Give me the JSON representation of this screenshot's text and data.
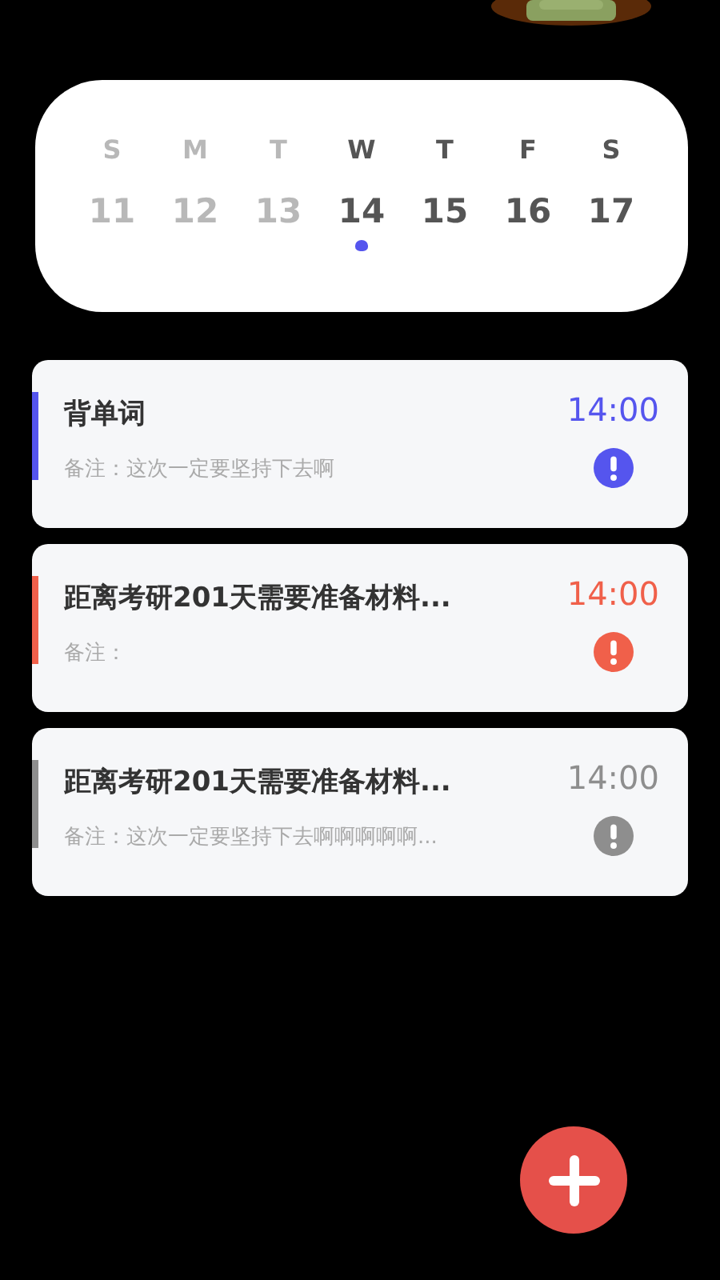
{
  "week": {
    "days": [
      {
        "weekday": "S",
        "date": "11",
        "past": true,
        "selected": false
      },
      {
        "weekday": "M",
        "date": "12",
        "past": true,
        "selected": false
      },
      {
        "weekday": "T",
        "date": "13",
        "past": true,
        "selected": false
      },
      {
        "weekday": "W",
        "date": "14",
        "past": false,
        "selected": true
      },
      {
        "weekday": "T",
        "date": "15",
        "past": false,
        "selected": false
      },
      {
        "weekday": "F",
        "date": "16",
        "past": false,
        "selected": false
      },
      {
        "weekday": "S",
        "date": "17",
        "past": false,
        "selected": false
      }
    ]
  },
  "tasks": [
    {
      "title": "背单词",
      "note": "备注：这次一定要坚持下去啊",
      "time": "14:00",
      "color": "#5555ee"
    },
    {
      "title": "距离考研201天需要准备材料...",
      "note": "备注：",
      "time": "14:00",
      "color": "#f0604a"
    },
    {
      "title": "距离考研201天需要准备材料...",
      "note": "备注：这次一定要坚持下去啊啊啊啊啊...",
      "time": "14:00",
      "color": "#8e8e8e"
    }
  ]
}
